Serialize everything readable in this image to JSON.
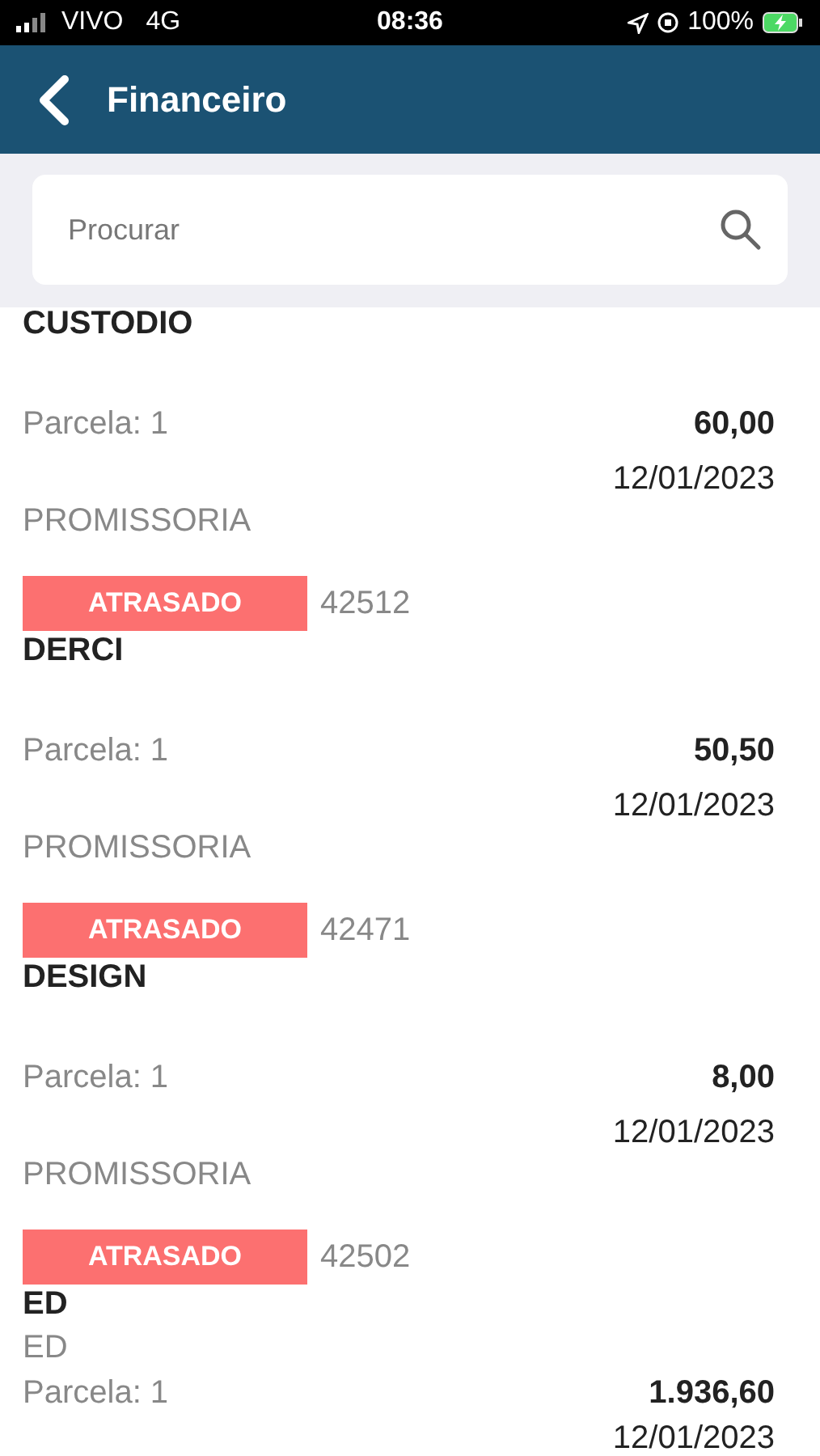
{
  "status_bar": {
    "carrier": "VIVO",
    "network": "4G",
    "time": "08:36",
    "battery": "100%"
  },
  "header": {
    "title": "Financeiro"
  },
  "search": {
    "placeholder": "Procurar"
  },
  "entries": [
    {
      "name": "CUSTODIO",
      "installment": "Parcela: 1",
      "amount": "60,00",
      "date": "12/01/2023",
      "type": "PROMISSORIA",
      "status": "ATRASADO",
      "number": "42512"
    },
    {
      "name": "DERCI",
      "installment": "Parcela: 1",
      "amount": "50,50",
      "date": "12/01/2023",
      "type": "PROMISSORIA",
      "status": "ATRASADO",
      "number": "42471"
    },
    {
      "name": "DESIGN",
      "installment": "Parcela: 1",
      "amount": "8,00",
      "date": "12/01/2023",
      "type": "PROMISSORIA",
      "status": "ATRASADO",
      "number": "42502"
    },
    {
      "name": "ED",
      "subtitle": "ED",
      "installment": "Parcela: 1",
      "amount": "1.936,60",
      "date": "12/01/2023"
    }
  ]
}
